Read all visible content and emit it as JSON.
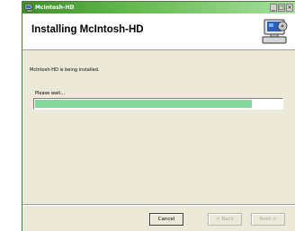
{
  "window": {
    "title": "McIntosh-HD",
    "controls": {
      "minimize": "_",
      "maximize": "□",
      "close": "×"
    }
  },
  "header": {
    "title": "Installing McIntosh-HD",
    "art_icon": "computer-installer-icon"
  },
  "content": {
    "status": "McIntosh-HD is being installed.",
    "wait_label": "Please wait...",
    "progress_percent": 88
  },
  "buttons": {
    "cancel": "Cancel",
    "back": "< Back",
    "next": "Next >"
  },
  "colors": {
    "titlebar": "#5fb548",
    "progress_fill": "#86d99c",
    "dialog_bg": "#ece9d8"
  }
}
